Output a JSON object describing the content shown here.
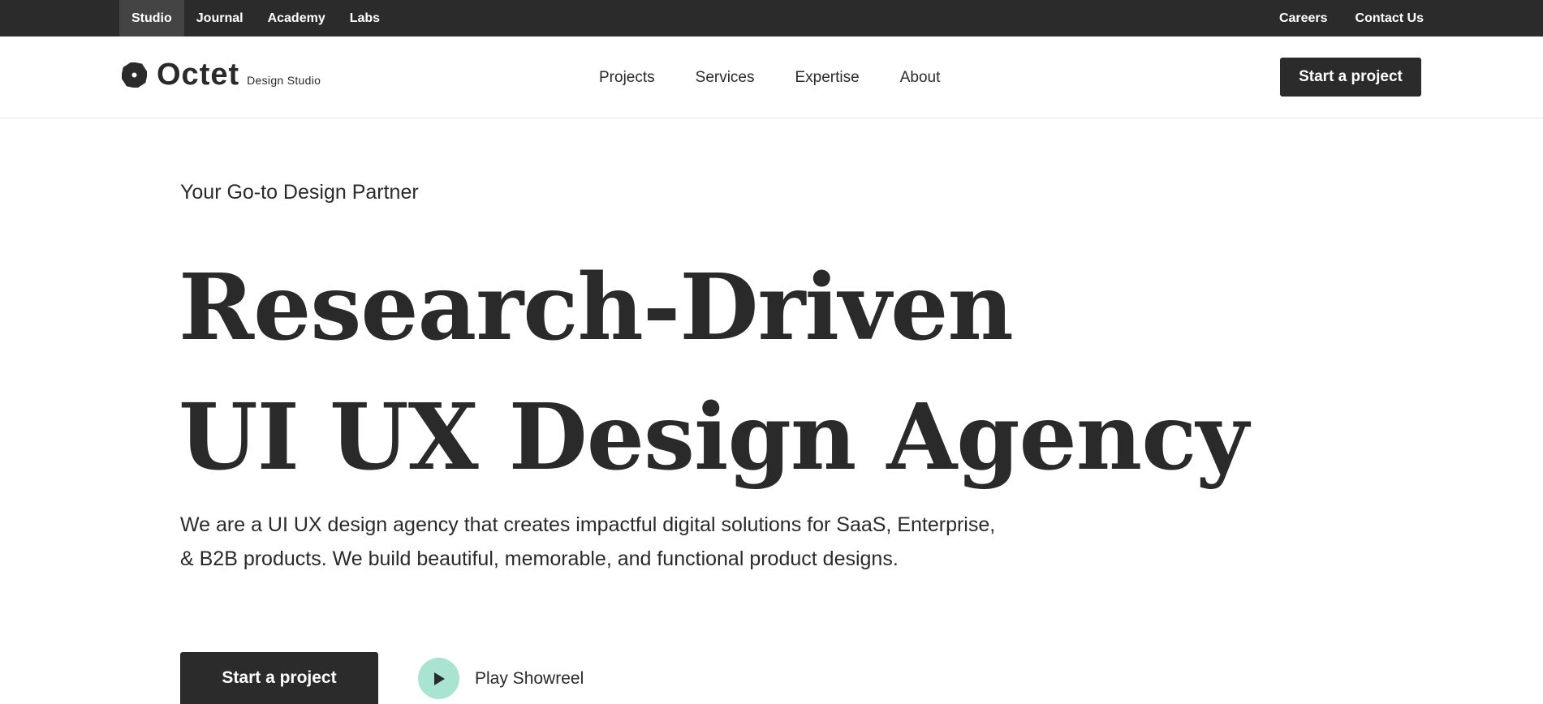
{
  "topbar": {
    "left_links": [
      {
        "label": "Studio",
        "active": true
      },
      {
        "label": "Journal",
        "active": false
      },
      {
        "label": "Academy",
        "active": false
      },
      {
        "label": "Labs",
        "active": false
      }
    ],
    "right_links": [
      {
        "label": "Careers"
      },
      {
        "label": "Contact Us"
      }
    ]
  },
  "header": {
    "brand_name": "Octet",
    "brand_sub": "Design Studio",
    "nav": [
      {
        "label": "Projects"
      },
      {
        "label": "Services"
      },
      {
        "label": "Expertise"
      },
      {
        "label": "About"
      }
    ],
    "cta_label": "Start a project"
  },
  "hero": {
    "eyebrow": "Your Go-to Design Partner",
    "headline_line1": "Research-Driven",
    "headline_line2": "UI UX Design Agency",
    "intro": "We are a UI UX design agency that creates impactful digital solutions for SaaS, Enterprise, & B2B products. We build beautiful, memorable, and functional product designs.",
    "cta_label": "Start a project",
    "showreel_label": "Play Showreel"
  },
  "colors": {
    "dark": "#2b2b2b",
    "accent_mint": "#a9e4d3",
    "topbar_active": "#444444"
  },
  "icons": {
    "brand": "octagon-logo-icon",
    "showreel": "play-icon"
  }
}
